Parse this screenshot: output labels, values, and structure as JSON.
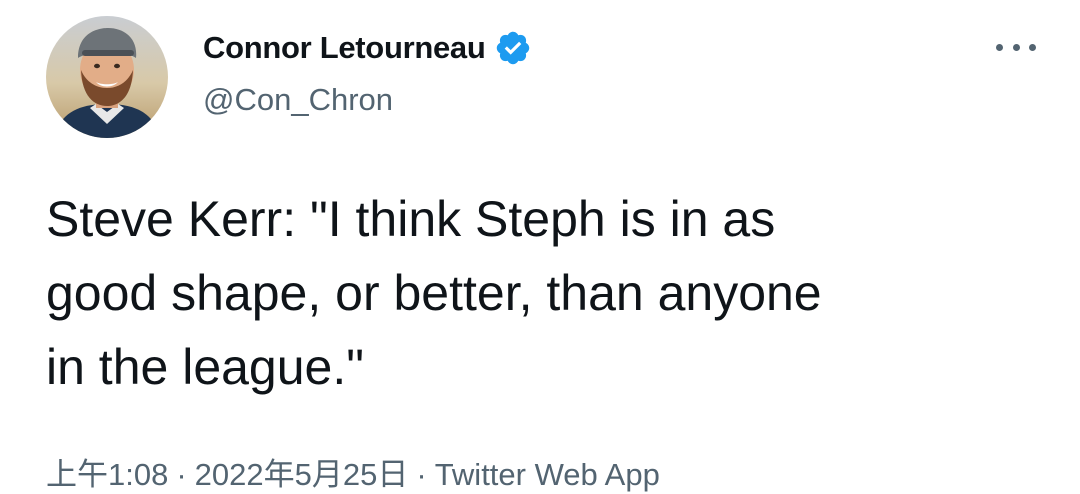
{
  "author": {
    "display_name": "Connor Letourneau",
    "handle": "@Con_Chron",
    "verified": true,
    "verified_icon": "verified-badge-icon",
    "verified_color": "#1d9bf0"
  },
  "tweet": {
    "text": "Steve Kerr: \"I think Steph is in as\ngood shape, or better, than anyone\nin the league.\"",
    "time": "上午1:08",
    "separator": "·",
    "date": "2022年5月25日",
    "source": "Twitter Web App"
  },
  "menu": {
    "icon": "more-options-icon"
  },
  "colors": {
    "text_primary": "#0f1419",
    "text_secondary": "#536471",
    "accent": "#1d9bf0"
  }
}
